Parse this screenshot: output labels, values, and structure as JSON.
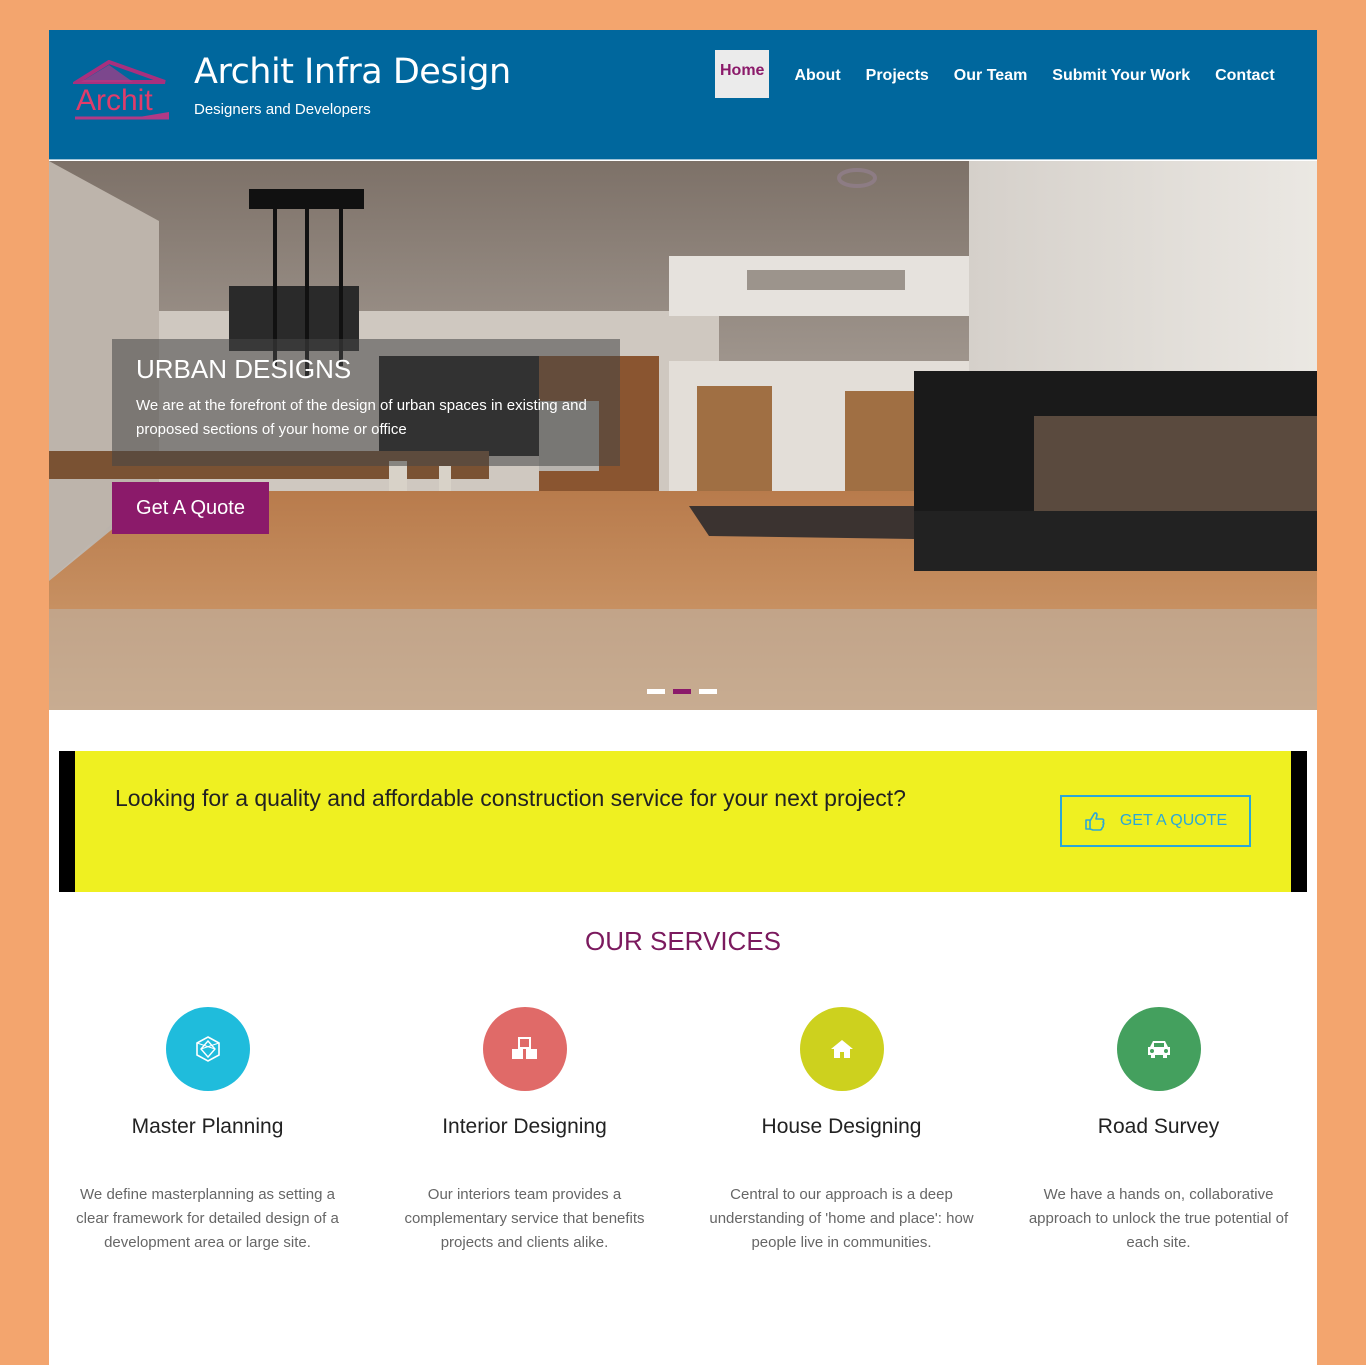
{
  "brand": {
    "logo_text": "Archit",
    "title": "Archit Infra Design",
    "tagline": "Designers and Developers"
  },
  "nav": {
    "items": [
      {
        "label": "Home",
        "active": true
      },
      {
        "label": "About"
      },
      {
        "label": "Projects"
      },
      {
        "label": "Our Team"
      },
      {
        "label": "Submit Your Work"
      },
      {
        "label": "Contact"
      }
    ]
  },
  "hero": {
    "slide_title": "URBAN DESIGNS",
    "slide_text": "We are at the forefront of the design of urban spaces in existing and proposed sections of your home or office",
    "button_label": "Get A Quote",
    "slide_count": 3,
    "active_slide": 2
  },
  "cta": {
    "text": "Looking for a quality and affordable construction service for your next project?",
    "button_label": "GET A QUOTE",
    "button_icon": "thumbs-up-icon"
  },
  "services": {
    "title": "OUR SERVICES",
    "items": [
      {
        "name": "Master Planning",
        "icon": "geometric-shape-icon",
        "color": "#1fbcdc",
        "description": "We define masterplanning as setting a clear framework for detailed design of a development area or large site."
      },
      {
        "name": "Interior Designing",
        "icon": "cubes-icon",
        "color": "#e06a68",
        "description": "Our interiors team provides a complementary service that benefits projects and clients alike."
      },
      {
        "name": "House Designing",
        "icon": "home-icon",
        "color": "#cdd11e",
        "description": "Central to our approach is a deep understanding of 'home and place': how people live in communities."
      },
      {
        "name": "Road Survey",
        "icon": "car-icon",
        "color": "#44a05e",
        "description": "We have a hands on, collaborative approach to unlock the true potential of each site."
      }
    ]
  },
  "colors": {
    "background": "#f3a56e",
    "header": "#00679d",
    "accent": "#8b1a6a",
    "cta_background": "#eff021",
    "cta_button": "#2ba7d7"
  }
}
